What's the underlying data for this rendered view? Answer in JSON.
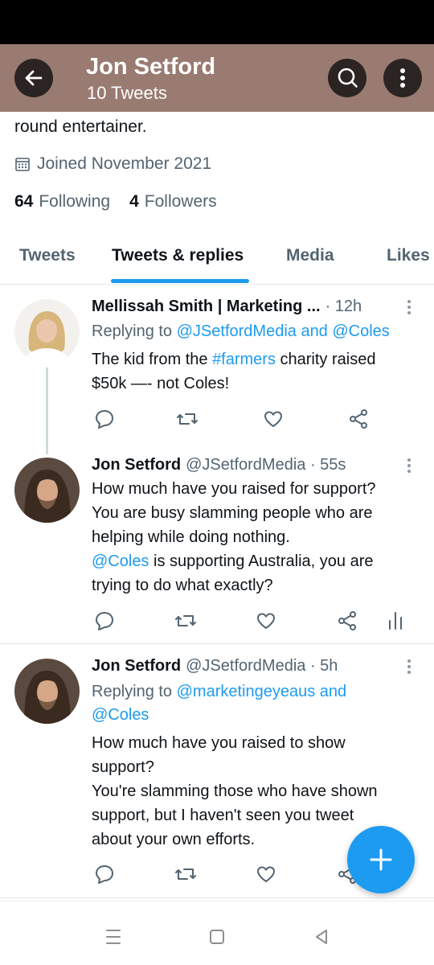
{
  "header": {
    "name": "Jon Setford",
    "tweet_count": "10 Tweets",
    "icons": [
      "back-arrow-icon",
      "search-icon",
      "more-vertical-icon"
    ],
    "color": "#9a7b71"
  },
  "profile": {
    "bio_tail": "round entertainer.",
    "joined": "Joined November 2021",
    "following_count": "64",
    "following_label": "Following",
    "followers_count": "4",
    "followers_label": "Followers"
  },
  "tabs": [
    {
      "label": "Tweets",
      "active": false
    },
    {
      "label": "Tweets & replies",
      "active": true
    },
    {
      "label": "Media",
      "active": false
    },
    {
      "label": "Likes",
      "active": false
    }
  ],
  "accent_color": "#1d9bf0",
  "tweets": [
    {
      "author": "Mellissah Smith | Marketing ...",
      "handle": "",
      "time": "· 12h",
      "replying_prefix": "Replying to ",
      "replying_to": "@JSetfordMedia and @Coles",
      "lines": [
        {
          "a": "The kid from the ",
          "b": "#farmers",
          "c": " charity raised"
        },
        {
          "a": "$50k —- not Coles!"
        }
      ]
    },
    {
      "author": "Jon Setford",
      "handle": "@JSetfordMedia",
      "time": "· 55s",
      "lines": [
        {
          "a": "How much have you raised for support?"
        },
        {
          "a": "You are busy slamming people who are"
        },
        {
          "a": "helping while doing nothing."
        },
        {
          "b": "@Coles",
          "c": " is supporting Australia, you are"
        },
        {
          "a": "trying to do what exactly?"
        }
      ]
    },
    {
      "author": "Jon Setford",
      "handle": "@JSetfordMedia",
      "time": "· 5h",
      "replying_prefix": "Replying to ",
      "replying_to": "@marketingeyeaus and",
      "replying_to_2": "@Coles",
      "lines": [
        {
          "a": "How much have you raised to show"
        },
        {
          "a": "support?"
        },
        {
          "a": "You're slamming those who have shown"
        },
        {
          "a": "support, but I haven't seen you tweet"
        },
        {
          "a": "about your own efforts."
        }
      ]
    }
  ],
  "action_icons": [
    "reply-icon",
    "retweet-icon",
    "like-icon",
    "share-icon",
    "analytics-icon"
  ],
  "fab_icon": "plus-icon",
  "nav_icons": [
    "recents-icon",
    "home-icon",
    "back-icon"
  ]
}
